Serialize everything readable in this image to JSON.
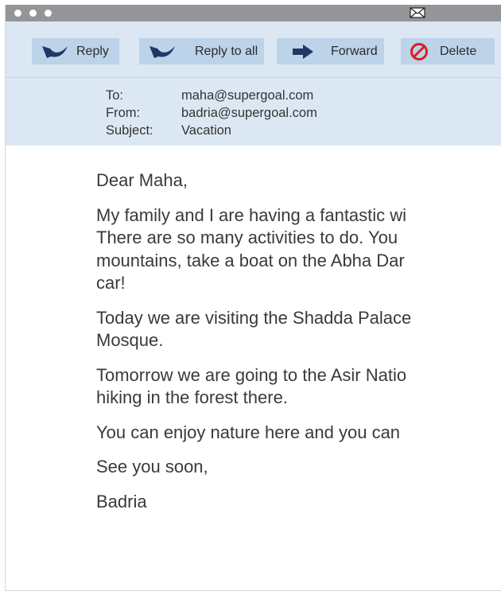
{
  "toolbar": {
    "reply_label": "Reply",
    "reply_all_label": "Reply to all",
    "forward_label": "Forward",
    "delete_label": "Delete"
  },
  "headers": {
    "to_label": "To:",
    "to_value": "maha@supergoal.com",
    "from_label": "From:",
    "from_value": "badria@supergoal.com",
    "subject_label": "Subject:",
    "subject_value": "Vacation"
  },
  "body": {
    "greeting": "Dear Maha,",
    "p1": [
      "My family and I are having a fantastic wi",
      "There are so many activities to do. You",
      "mountains, take a boat on the Abha Dar",
      "car!"
    ],
    "p2": [
      "Today we are visiting the Shadda Palace",
      "Mosque."
    ],
    "p3": [
      "Tomorrow we are going to the Asir Natio",
      "hiking in the forest there."
    ],
    "p4": "You can enjoy nature here and you can",
    "closing": "See you soon,",
    "signature": "Badria"
  },
  "icons": {
    "reply": "reply-arrow-icon",
    "reply_all": "reply-all-arrow-icon",
    "forward": "forward-arrow-icon",
    "delete": "no-entry-icon",
    "window": "envelope-icon"
  },
  "colors": {
    "titlebar": "#939598",
    "toolbar_bg": "#dbe8f4",
    "button_bg": "#bcd3ea",
    "icon_navy": "#1f3864",
    "delete_red": "#d9201f"
  }
}
